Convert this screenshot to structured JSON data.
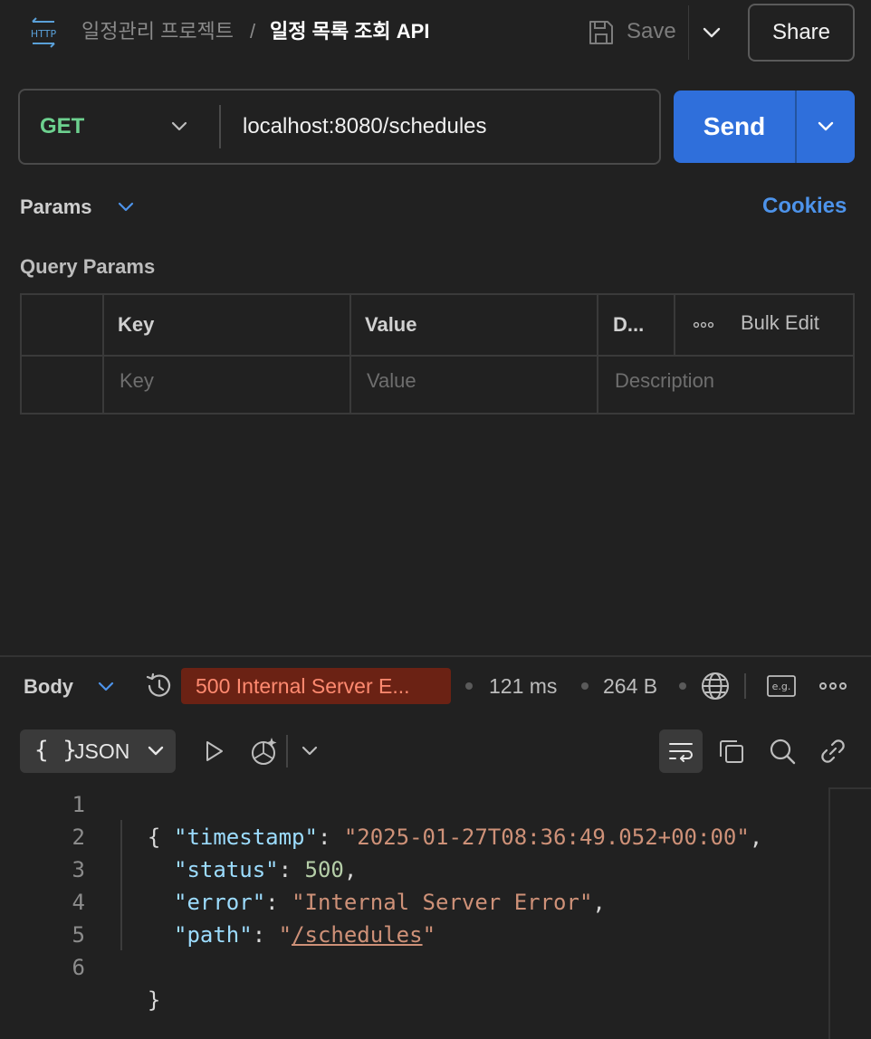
{
  "header": {
    "http_icon_text": "HTTP",
    "breadcrumb_parent": "일정관리 프로젝트",
    "breadcrumb_separator": "/",
    "breadcrumb_current": "일정 목록 조회 API",
    "save_label": "Save",
    "share_label": "Share"
  },
  "request": {
    "method": "GET",
    "url": "localhost:8080/schedules",
    "send_label": "Send"
  },
  "params": {
    "tab_label": "Params",
    "cookies_label": "Cookies",
    "query_params_title": "Query Params",
    "columns": [
      "Key",
      "Value",
      "D..."
    ],
    "bulk_edit_label": "Bulk Edit",
    "placeholders": {
      "key": "Key",
      "value": "Value",
      "description": "Description"
    }
  },
  "response": {
    "body_label": "Body",
    "status": "500 Internal Server E...",
    "time": "121 ms",
    "size": "264 B",
    "eg_icon_text": "e.g.",
    "format_braces": "{ }",
    "format_label": "JSON",
    "line_numbers": [
      "1",
      "2",
      "3",
      "4",
      "5",
      "6"
    ],
    "json": {
      "open": "{",
      "close": "}",
      "timestamp_key": "\"timestamp\"",
      "timestamp_value": "\"2025-01-27T08:36:49.052+00:00\"",
      "status_key": "\"status\"",
      "status_value": "500",
      "error_key": "\"error\"",
      "error_value": "\"Internal Server Error\"",
      "path_key": "\"path\"",
      "path_value_open": "\"",
      "path_value_link": "/schedules",
      "path_value_close": "\""
    }
  },
  "colors": {
    "background": "#212121",
    "accent_blue": "#2f6fdb",
    "method_green": "#6dd18f",
    "error_badge_bg": "#6b2214",
    "error_badge_text": "#ff8a70",
    "link_blue": "#4d93ea"
  },
  "icons": [
    "http-icon",
    "save-icon",
    "chevron-down-icon",
    "history-icon",
    "globe-icon",
    "example-icon",
    "more-icon",
    "play-icon",
    "visualize-icon",
    "wrap-icon",
    "copy-icon",
    "search-icon",
    "link-icon",
    "dots-icon"
  ]
}
